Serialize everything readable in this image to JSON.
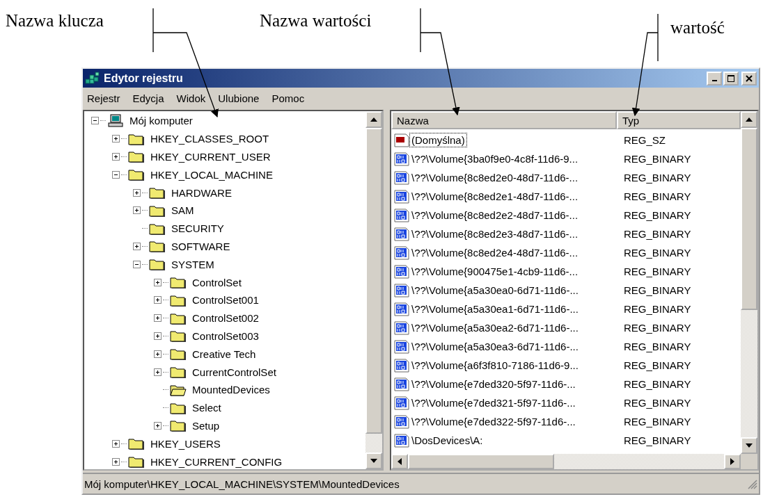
{
  "annotations": [
    {
      "label": "Nazwa klucza"
    },
    {
      "label": "Nazwa wartości"
    },
    {
      "label": "wartość"
    }
  ],
  "window": {
    "title": "Edytor rejestru"
  },
  "menu": [
    "Rejestr",
    "Edycja",
    "Widok",
    "Ulubione",
    "Pomoc"
  ],
  "tree": [
    {
      "label": "Mój komputer",
      "kind": "computer",
      "expanded": true,
      "selected": false,
      "children": [
        {
          "label": "HKEY_CLASSES_ROOT",
          "kind": "folder",
          "expanded": false,
          "selected": false
        },
        {
          "label": "HKEY_CURRENT_USER",
          "kind": "folder",
          "expanded": false,
          "selected": false
        },
        {
          "label": "HKEY_LOCAL_MACHINE",
          "kind": "folder",
          "expanded": true,
          "selected": false,
          "children": [
            {
              "label": "HARDWARE",
              "kind": "folder",
              "expanded": false,
              "selected": false
            },
            {
              "label": "SAM",
              "kind": "folder",
              "expanded": false,
              "selected": false
            },
            {
              "label": "SECURITY",
              "kind": "folder",
              "selected": false
            },
            {
              "label": "SOFTWARE",
              "kind": "folder",
              "expanded": false,
              "selected": false
            },
            {
              "label": "SYSTEM",
              "kind": "folder",
              "expanded": true,
              "selected": false,
              "children": [
                {
                  "label": "ControlSet",
                  "kind": "folder",
                  "expanded": false,
                  "selected": false
                },
                {
                  "label": "ControlSet001",
                  "kind": "folder",
                  "expanded": false,
                  "selected": false
                },
                {
                  "label": "ControlSet002",
                  "kind": "folder",
                  "expanded": false,
                  "selected": false
                },
                {
                  "label": "ControlSet003",
                  "kind": "folder",
                  "expanded": false,
                  "selected": false
                },
                {
                  "label": "Creative Tech",
                  "kind": "folder",
                  "expanded": false,
                  "selected": false
                },
                {
                  "label": "CurrentControlSet",
                  "kind": "folder",
                  "expanded": false,
                  "selected": false
                },
                {
                  "label": "MountedDevices",
                  "kind": "folder",
                  "selected": true
                },
                {
                  "label": "Select",
                  "kind": "folder",
                  "selected": false
                },
                {
                  "label": "Setup",
                  "kind": "folder",
                  "expanded": false,
                  "selected": false
                }
              ]
            }
          ]
        },
        {
          "label": "HKEY_USERS",
          "kind": "folder",
          "expanded": false,
          "selected": false
        },
        {
          "label": "HKEY_CURRENT_CONFIG",
          "kind": "folder",
          "expanded": false,
          "selected": false
        }
      ]
    }
  ],
  "values": {
    "columns": [
      "Nazwa",
      "Typ"
    ],
    "rows": [
      {
        "kind": "string",
        "name": "(Domyślna)",
        "type": "REG_SZ",
        "selected": true
      },
      {
        "kind": "binary",
        "name": "\\??\\Volume{3ba0f9e0-4c8f-11d6-9...",
        "type": "REG_BINARY",
        "selected": false
      },
      {
        "kind": "binary",
        "name": "\\??\\Volume{8c8ed2e0-48d7-11d6-...",
        "type": "REG_BINARY",
        "selected": false
      },
      {
        "kind": "binary",
        "name": "\\??\\Volume{8c8ed2e1-48d7-11d6-...",
        "type": "REG_BINARY",
        "selected": false
      },
      {
        "kind": "binary",
        "name": "\\??\\Volume{8c8ed2e2-48d7-11d6-...",
        "type": "REG_BINARY",
        "selected": false
      },
      {
        "kind": "binary",
        "name": "\\??\\Volume{8c8ed2e3-48d7-11d6-...",
        "type": "REG_BINARY",
        "selected": false
      },
      {
        "kind": "binary",
        "name": "\\??\\Volume{8c8ed2e4-48d7-11d6-...",
        "type": "REG_BINARY",
        "selected": false
      },
      {
        "kind": "binary",
        "name": "\\??\\Volume{900475e1-4cb9-11d6-...",
        "type": "REG_BINARY",
        "selected": false
      },
      {
        "kind": "binary",
        "name": "\\??\\Volume{a5a30ea0-6d71-11d6-...",
        "type": "REG_BINARY",
        "selected": false
      },
      {
        "kind": "binary",
        "name": "\\??\\Volume{a5a30ea1-6d71-11d6-...",
        "type": "REG_BINARY",
        "selected": false
      },
      {
        "kind": "binary",
        "name": "\\??\\Volume{a5a30ea2-6d71-11d6-...",
        "type": "REG_BINARY",
        "selected": false
      },
      {
        "kind": "binary",
        "name": "\\??\\Volume{a5a30ea3-6d71-11d6-...",
        "type": "REG_BINARY",
        "selected": false
      },
      {
        "kind": "binary",
        "name": "\\??\\Volume{a6f3f810-7186-11d6-9...",
        "type": "REG_BINARY",
        "selected": false
      },
      {
        "kind": "binary",
        "name": "\\??\\Volume{e7ded320-5f97-11d6-...",
        "type": "REG_BINARY",
        "selected": false
      },
      {
        "kind": "binary",
        "name": "\\??\\Volume{e7ded321-5f97-11d6-...",
        "type": "REG_BINARY",
        "selected": false
      },
      {
        "kind": "binary",
        "name": "\\??\\Volume{e7ded322-5f97-11d6-...",
        "type": "REG_BINARY",
        "selected": false
      },
      {
        "kind": "binary",
        "name": "\\DosDevices\\A:",
        "type": "REG_BINARY",
        "selected": false
      }
    ]
  },
  "status_bar": "Mój komputer\\HKEY_LOCAL_MACHINE\\SYSTEM\\MountedDevices"
}
